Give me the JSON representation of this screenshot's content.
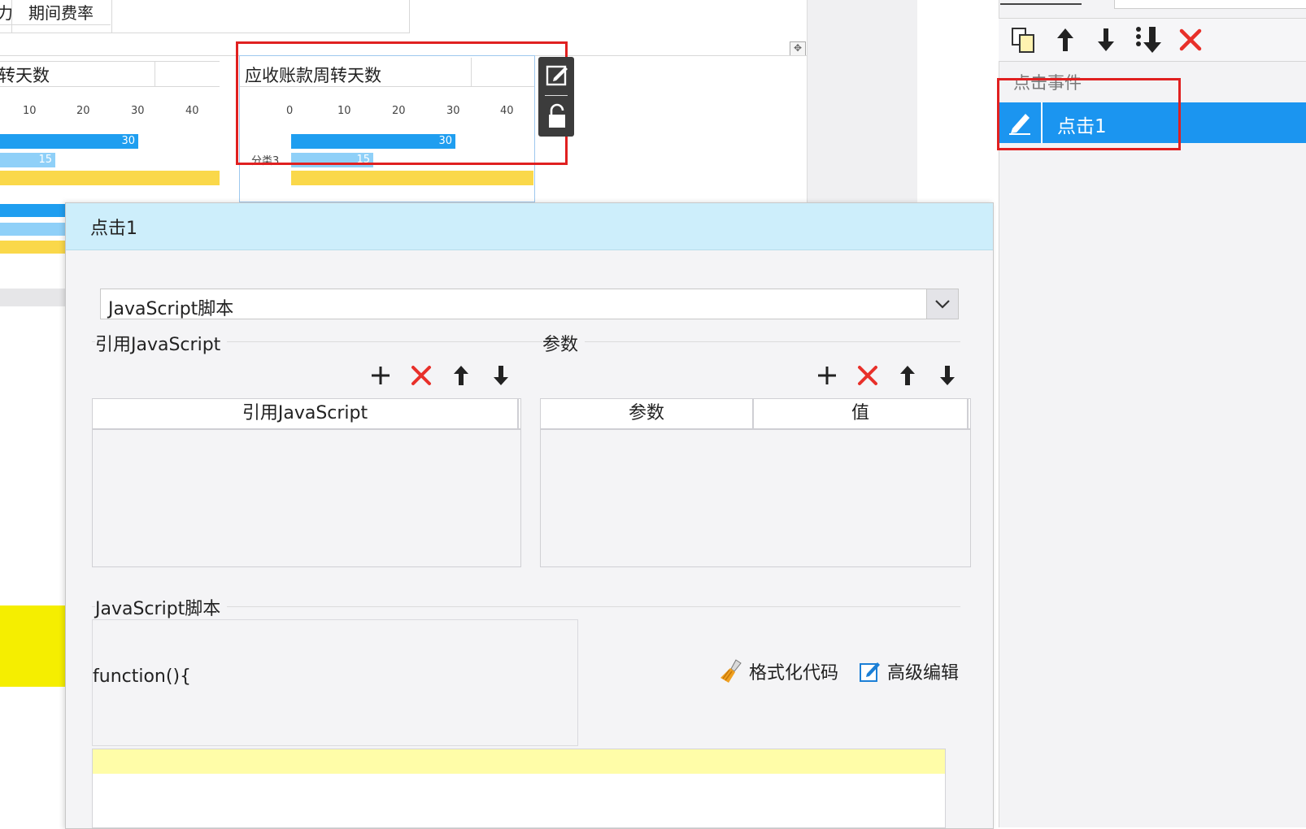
{
  "background": {
    "top_table": {
      "left_fragment": "力",
      "header": "期间费率"
    },
    "chart_left": {
      "title_fragment": "转天数",
      "ticks": [
        "10",
        "20",
        "30",
        "40"
      ],
      "bar_labels": [
        "30",
        "15"
      ]
    },
    "chart_right": {
      "title": "应收账款周转天数",
      "ticks": [
        "0",
        "10",
        "20",
        "30",
        "40"
      ],
      "bar_labels": [
        "30",
        "15"
      ],
      "category_label": "分类3"
    }
  },
  "right_panel": {
    "toolbar": {
      "copy_icon": "copy-icon",
      "up_icon": "arrow-up-icon",
      "down_icon": "arrow-down-icon",
      "move_bottom_icon": "move-to-bottom-icon",
      "delete_icon": "delete-x-icon"
    },
    "section_title": "点击事件",
    "selected_item": "点击1"
  },
  "dialog": {
    "title": "点击1",
    "type_select": "JavaScript脚本",
    "ref_js_group": "引用JavaScript",
    "ref_js_table_header": "引用JavaScript",
    "params_group": "参数",
    "params_headers": [
      "参数",
      "值"
    ],
    "script_group": "JavaScript脚本",
    "code_text": "function(){",
    "format_code_label": "格式化代码",
    "advanced_edit_label": "高级编辑"
  },
  "colors": {
    "accent_blue": "#1b95f0",
    "title_bar": "#cdeefb",
    "red_x": "#e8302a",
    "highlight_yellow": "#fffda8"
  }
}
